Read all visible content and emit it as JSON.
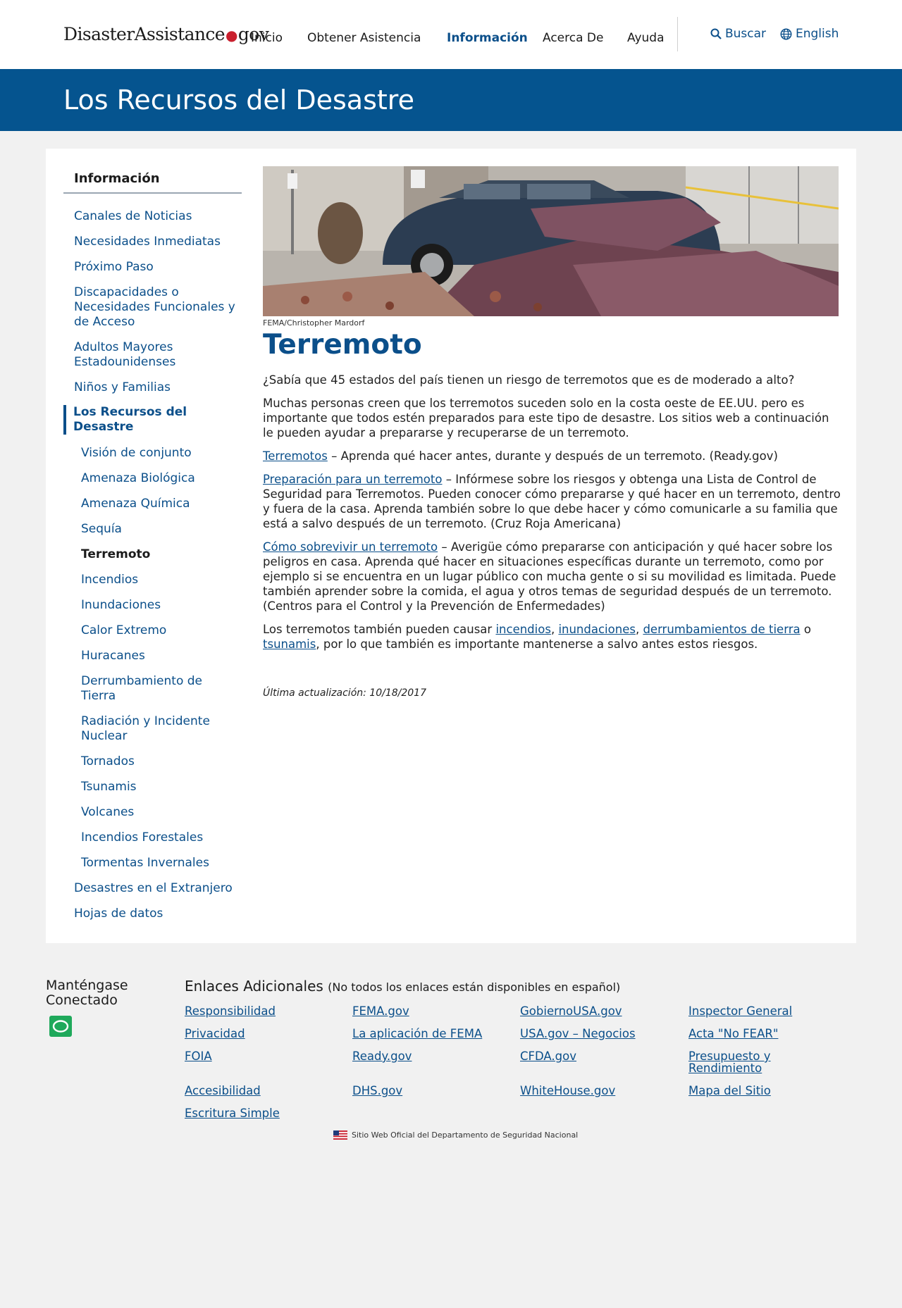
{
  "header": {
    "logo_main": "DisasterAssistance",
    "logo_tld": "gov",
    "nav": [
      "Inicio",
      "Obtener Asistencia",
      "Información",
      "Acerca De",
      "Ayuda"
    ],
    "search": "Buscar",
    "language": "English"
  },
  "banner": {
    "title": "Los Recursos del Desastre"
  },
  "sidebar": {
    "title": "Información",
    "items": [
      "Canales de Noticias",
      "Necesidades Inmediatas",
      "Próximo Paso",
      "Discapacidades o Necesidades Funcionales y de Acceso",
      "Adultos Mayores Estadounidenses",
      "Niños y Familias",
      "Los Recursos del Desastre"
    ],
    "subitems": [
      "Visión de conjunto",
      "Amenaza Biológica",
      "Amenaza Química",
      "Sequía",
      "Terremoto",
      "Incendios",
      "Inundaciones",
      "Calor Extremo",
      "Huracanes",
      "Derrumbamiento de Tierra",
      "Radiación y Incidente Nuclear",
      "Tornados",
      "Tsunamis",
      "Volcanes",
      "Incendios Forestales",
      "Tormentas Invernales"
    ],
    "after": [
      "Desastres en el Extranjero",
      "Hojas de datos"
    ]
  },
  "article": {
    "photo_credit": "FEMA/Christopher Mardorf",
    "title": "Terremoto",
    "intro": "¿Sabía que 45 estados del país tienen un riesgo de terremotos que es de moderado a alto?",
    "p1": "Muchas personas creen que los terremotos suceden solo en la costa oeste de EE.UU. pero es importante que todos estén preparados para este tipo de desastre. Los sitios web a continuación le pueden ayudar a prepararse y recuperarse de un terremoto.",
    "l1": "Terremotos",
    "t1": " – Aprenda qué hacer antes, durante y después de un terremoto. (Ready.gov)",
    "l2": "Preparación para un terremoto",
    "t2": " – Infórmese sobre los riesgos y obtenga una Lista de Control de Seguridad para Terremotos. Pueden conocer cómo prepararse y qué hacer en un terremoto, dentro y fuera de la casa. Aprenda también sobre lo que debe hacer y cómo comunicarle a su familia que está a salvo después de un terremoto. (Cruz Roja Americana)",
    "l3": "Cómo sobrevivir un terremoto",
    "t3": " – Averigüe cómo prepararse con anticipación y qué hacer sobre los peligros en casa. Aprenda qué hacer en situaciones específicas durante un terremoto, como por ejemplo si se encuentra en un lugar público con mucha gente o si su movilidad es limitada. Puede también aprender sobre la comida, el agua y otros temas de seguridad después de un terremoto. (Centros para el Control y la Prevención de Enfermedades)",
    "p5_start": "Los terremotos también pueden causar ",
    "link_incendios": "incendios",
    "link_inundaciones": "inundaciones",
    "link_derrumb": "derrumbamientos de tierra",
    "o": " o ",
    "link_tsunamis": "tsunamis",
    "p5_end": ", por lo que también es importante mantenerse a salvo antes estos riesgos.",
    "updated": "Última actualización: 10/18/2017"
  },
  "footer": {
    "connect": "Manténgase Conectado",
    "links_title": "Enlaces Adicionales",
    "links_note": "(No todos los enlaces están disponibles en español)",
    "links": [
      "Responsibilidad",
      "FEMA.gov",
      "GobiernoUSA.gov",
      "Inspector General",
      "Privacidad",
      "La aplicación de FEMA",
      "USA.gov – Negocios",
      "Acta \"No FEAR\"",
      "FOIA",
      "Ready.gov",
      "CFDA.gov",
      "Presupuesto y Rendimiento",
      "Accesibilidad",
      "DHS.gov",
      "WhiteHouse.gov",
      "Mapa del Sitio",
      "Escritura Simple"
    ],
    "official": "Sitio Web Oficial del Departamento de Seguridad Nacional"
  },
  "colors": {
    "brand_blue": "#05548f",
    "link_blue": "#0b4f8a",
    "background": "#f1f1f1"
  },
  "icons": [
    "search-icon",
    "globe-icon",
    "chat-icon",
    "us-flag-icon"
  ]
}
